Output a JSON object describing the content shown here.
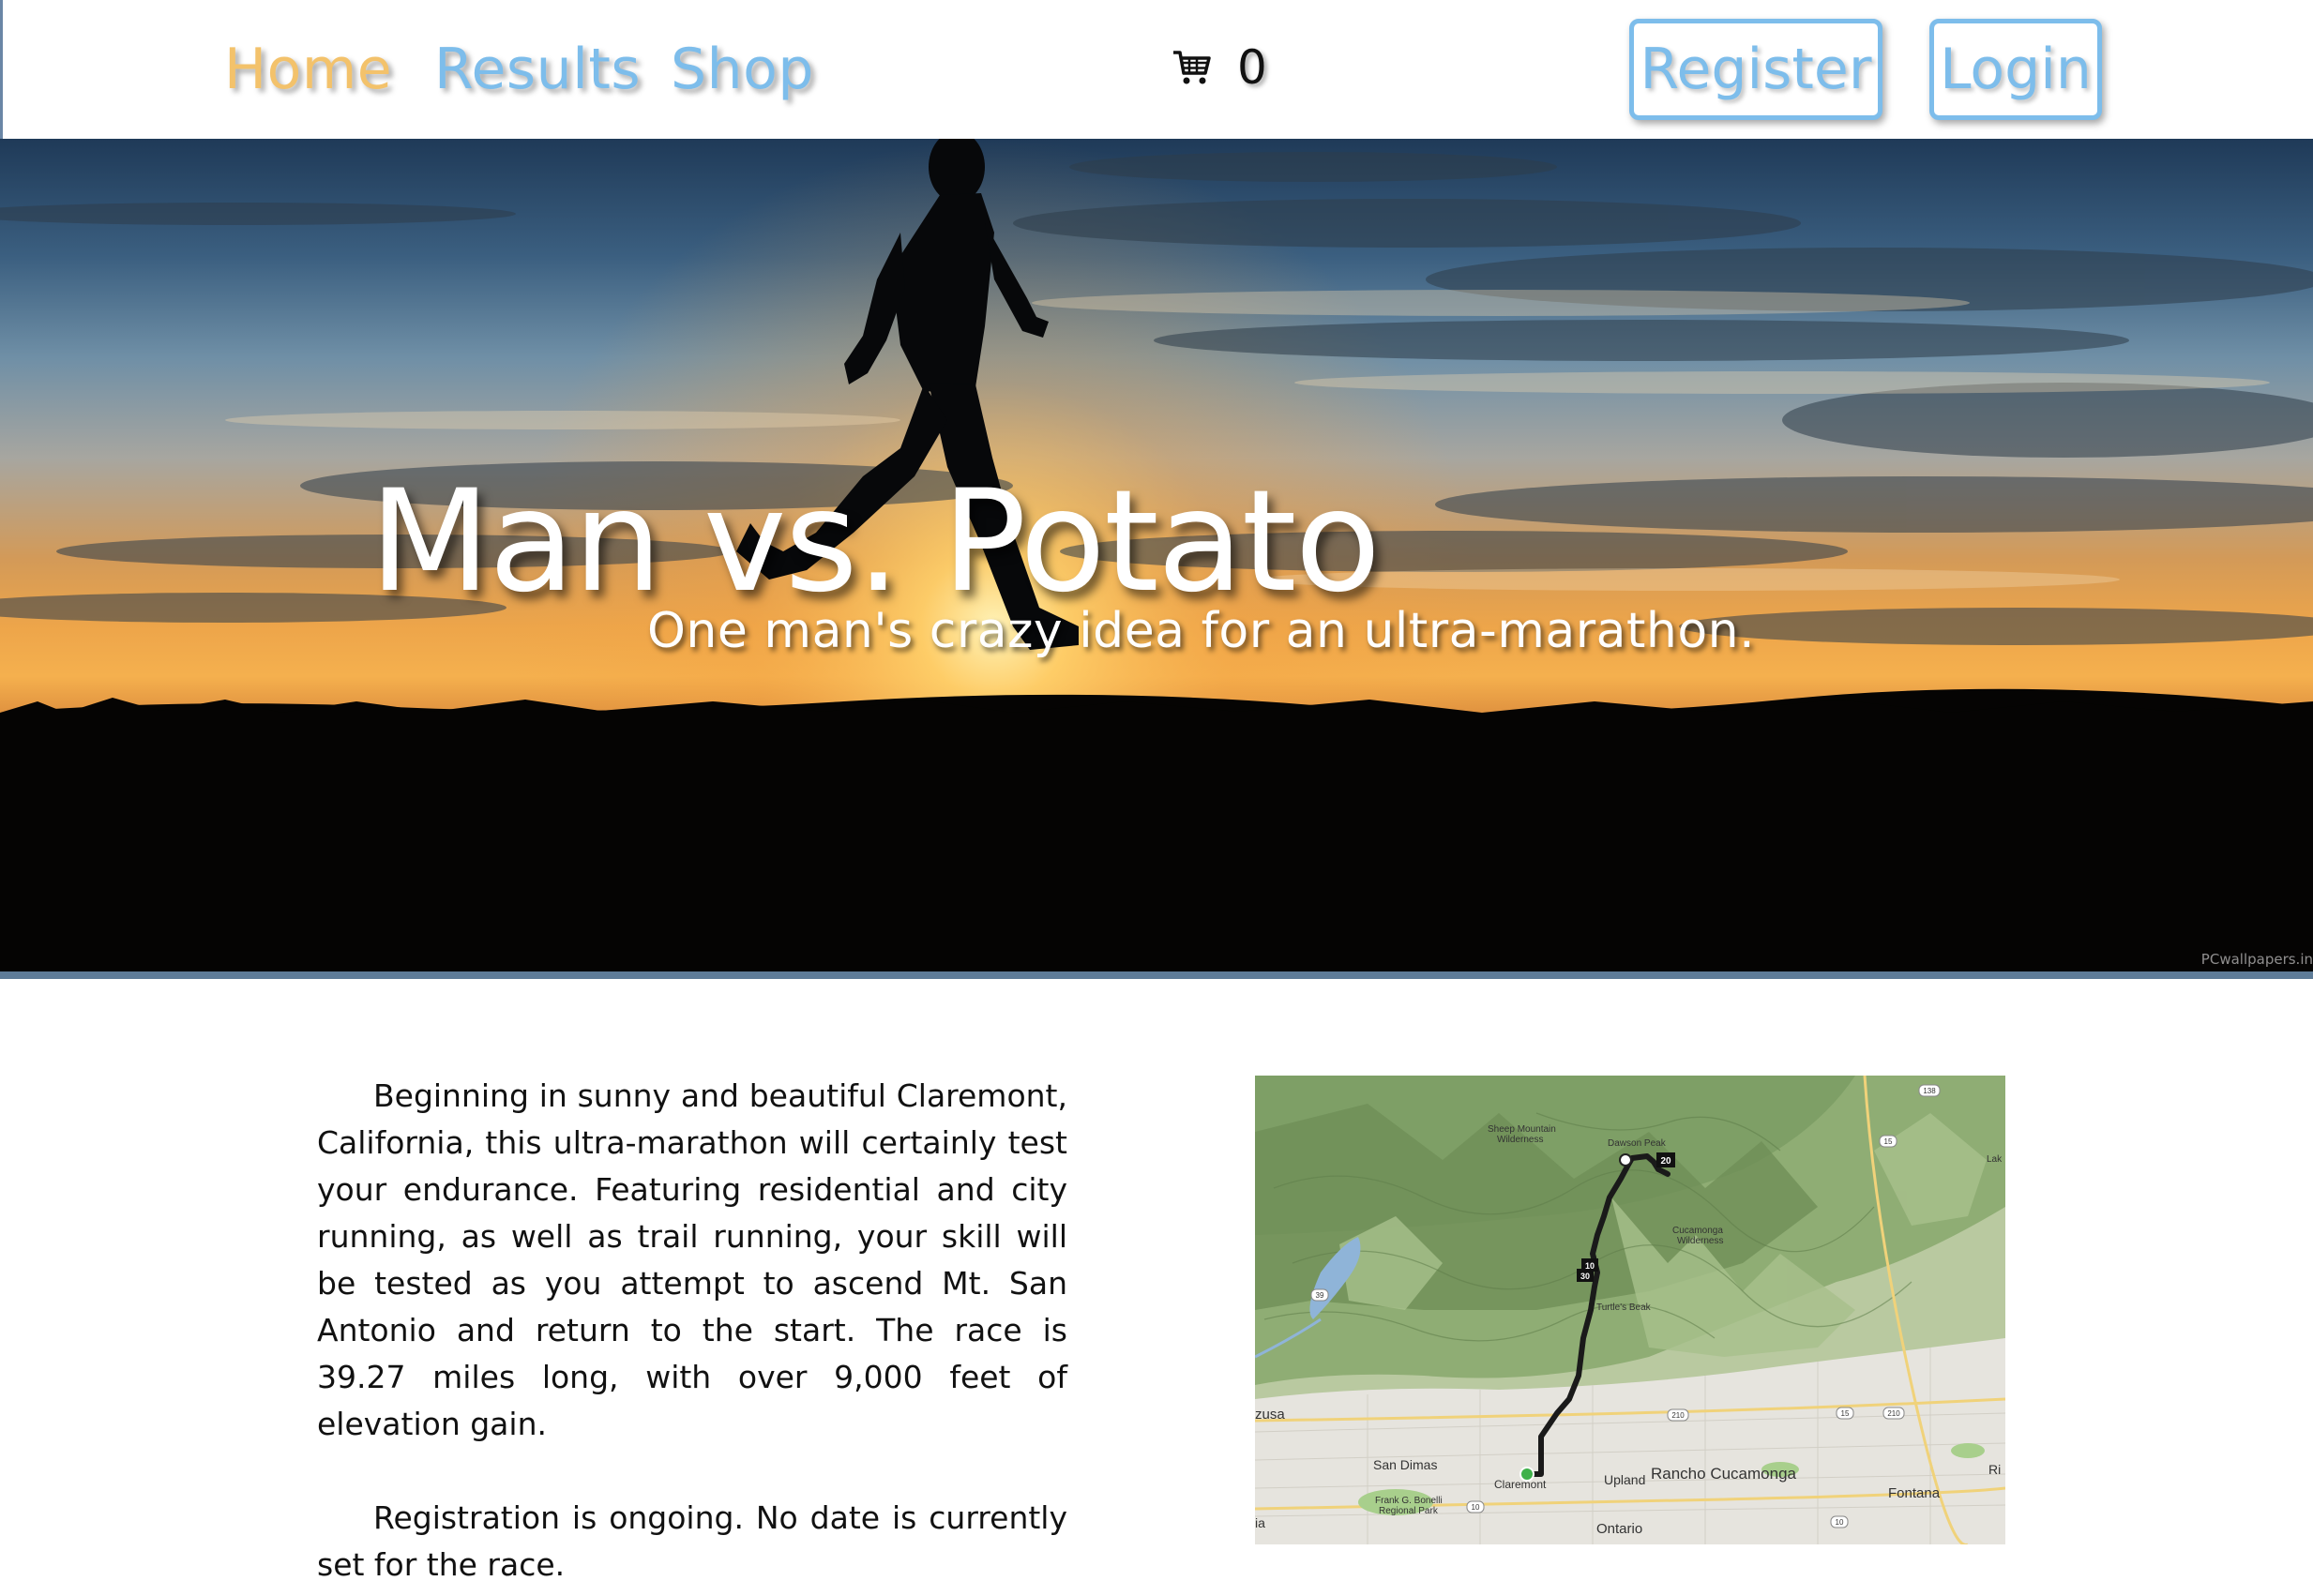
{
  "nav": {
    "links": [
      {
        "label": "Home"
      },
      {
        "label": "Results"
      },
      {
        "label": "Shop"
      }
    ],
    "cart": {
      "icon": "cart-icon",
      "count": "0"
    },
    "register_label": "Register",
    "login_label": "Login"
  },
  "hero": {
    "title": "Man vs. Potato",
    "subtitle": "One man's crazy idea for an ultra-marathon.",
    "credit": "PCwallpapers.in"
  },
  "content": {
    "paragraphs": [
      "Beginning in sunny and beautiful Claremont, California, this ultra-marathon will certainly test your endurance. Featuring residential and city running, as well as trail running, your skill will be tested as you attempt to ascend Mt. San Antonio and return to the start. The race is 39.27 miles long, with over 9,000 feet of elevation gain.",
      "Registration is ongoing. No date is currently set for the race."
    ]
  },
  "map": {
    "labels": {
      "sheep_mountain": "Sheep Mountain",
      "wilderness_1": "Wilderness",
      "dawson_peak": "Dawson Peak",
      "cucamonga": "Cucamonga",
      "wilderness_2": "Wilderness",
      "turtles_beak": "Turtle's Beak",
      "azusa": "zusa",
      "san_dimas": "San Dimas",
      "claremont": "Claremont",
      "upland": "Upland",
      "rancho_cucamonga": "Rancho Cucamonga",
      "fontana": "Fontana",
      "ontario": "Ontario",
      "frank_1": "Frank G. Bonelli",
      "frank_2": "Regional Park",
      "ri": "Ri",
      "lak": "Lak",
      "ia": "ia"
    },
    "markers": {
      "m20": "20",
      "m10": "10",
      "m30": "30"
    },
    "shields": {
      "s138": "138",
      "s39": "39",
      "s15a": "15",
      "s210a": "210",
      "s210b": "210",
      "s15b": "15",
      "s10a": "10",
      "s10b": "10"
    }
  },
  "colors": {
    "nav_active": "#f3c26b",
    "nav_link": "#7dbdeb",
    "button_outline": "#7dbdeb"
  }
}
